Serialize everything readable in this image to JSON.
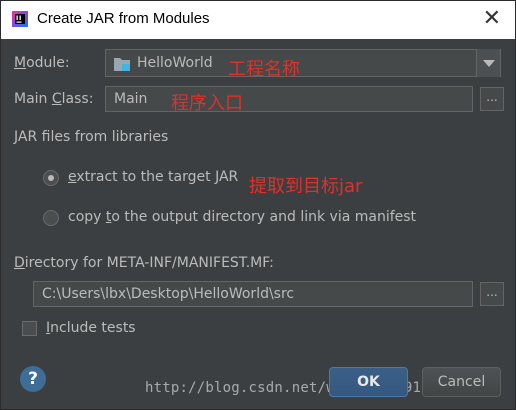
{
  "window": {
    "title": "Create JAR from Modules",
    "close_glyph": "✕",
    "app_icon": "intellij-idea-icon"
  },
  "module": {
    "label_prefix": "M",
    "label_rest": "odule:",
    "value": "HelloWorld",
    "annotation": "工程名称",
    "module_icon": "folder-module-icon"
  },
  "main_class": {
    "label_prefix": "Main ",
    "label_mnemonic": "C",
    "label_rest": "lass:",
    "value": "Main",
    "annotation": "程序入口",
    "browse_label": "..."
  },
  "libraries": {
    "label": "JAR files from libraries",
    "extract": {
      "mnemonic": "e",
      "label_rest": "xtract to the target JAR",
      "annotation": "提取到目标jar",
      "checked": true
    },
    "copy": {
      "label_a": "copy ",
      "mnemonic": "t",
      "label_b": "o the output directory and link via manifest",
      "checked": false
    }
  },
  "manifest": {
    "label_mnemonic": "D",
    "label_rest": "irectory for META-INF/MANIFEST.MF:",
    "value": "C:\\Users\\lbx\\Desktop\\HelloWorld\\src",
    "browse_label": "..."
  },
  "include_tests": {
    "mnemonic": "I",
    "label_rest": "nclude tests",
    "checked": false
  },
  "buttons": {
    "help": "?",
    "ok": "OK",
    "cancel": "Cancel"
  },
  "watermark": "http://blog.csdn.net/weixin_36910300",
  "colors": {
    "background": "#3c3f41",
    "annotation": "#e0302a",
    "ok_button": "#365880"
  }
}
